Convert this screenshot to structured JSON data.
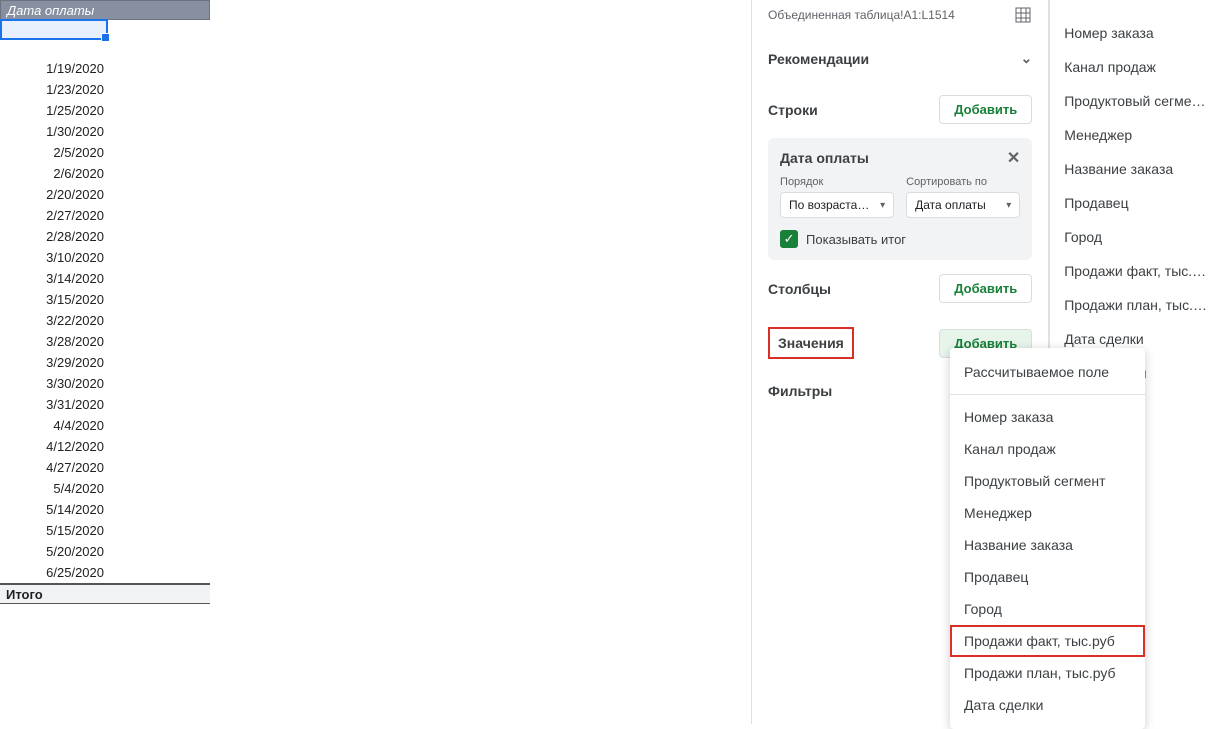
{
  "header": {
    "column_header": "Дата оплаты",
    "total_label": "Итого"
  },
  "dates": [
    "1/19/2020",
    "1/23/2020",
    "1/25/2020",
    "1/30/2020",
    "2/5/2020",
    "2/6/2020",
    "2/20/2020",
    "2/27/2020",
    "2/28/2020",
    "3/10/2020",
    "3/14/2020",
    "3/15/2020",
    "3/22/2020",
    "3/28/2020",
    "3/29/2020",
    "3/30/2020",
    "3/31/2020",
    "4/4/2020",
    "4/12/2020",
    "4/27/2020",
    "5/4/2020",
    "5/14/2020",
    "5/15/2020",
    "5/20/2020",
    "6/25/2020"
  ],
  "editor": {
    "range_label": "Объединенная таблица!A1:L1514",
    "recommendations": "Рекомендации",
    "rows_label": "Строки",
    "columns_label": "Столбцы",
    "values_label": "Значения",
    "filters_label": "Фильтры",
    "add_button": "Добавить",
    "field_card": {
      "title": "Дата оплаты",
      "order_label": "Порядок",
      "order_value": "По возраста…",
      "sort_label": "Сортировать по",
      "sort_value": "Дата оплаты",
      "show_total": "Показывать итог"
    }
  },
  "field_list": [
    "Номер заказа",
    "Канал продаж",
    "Продуктовый сегме…",
    "Менеджер",
    "Название заказа",
    "Продавец",
    "Город",
    "Продажи факт, тыс.…",
    "Продажи план, тыс.…",
    "Дата сделки",
    "Дата оплаты"
  ],
  "popup": {
    "calc_field": "Рассчитываемое поле",
    "items": [
      "Номер заказа",
      "Канал продаж",
      "Продуктовый сегмент",
      "Менеджер",
      "Название заказа",
      "Продавец",
      "Город",
      "Продажи факт, тыс.руб",
      "Продажи план, тыс.руб",
      "Дата сделки"
    ],
    "hl_index": 7
  }
}
